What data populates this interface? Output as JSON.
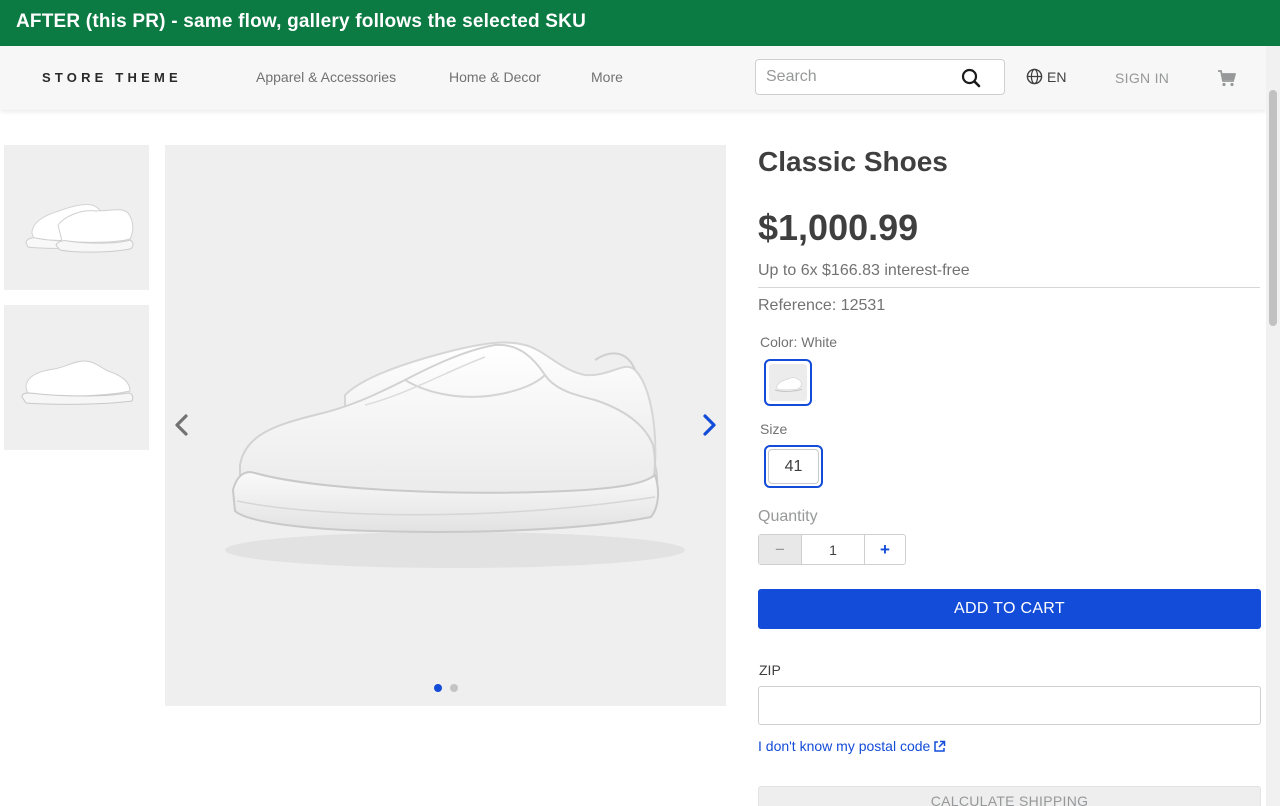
{
  "banner": {
    "text": "AFTER (this PR) - same flow, gallery follows the selected SKU",
    "color": "#0b7a43"
  },
  "header": {
    "logo": "STORE THEME",
    "nav": [
      {
        "label": "Apparel & Accessories"
      },
      {
        "label": "Home & Decor"
      },
      {
        "label": "More"
      }
    ],
    "search": {
      "placeholder": "Search",
      "value": "",
      "icon": "search-icon"
    },
    "language": {
      "label": "EN",
      "icon": "globe-icon"
    },
    "signin_label": "SIGN IN",
    "cart_icon": "cart-icon"
  },
  "gallery": {
    "thumbnails": [
      {
        "icon": "shoe-pair-thumbnail"
      },
      {
        "icon": "shoe-side-thumbnail"
      }
    ],
    "main_image": {
      "icon": "white-slip-on-shoe"
    },
    "prev_icon": "chevron-left-icon",
    "next_icon": "chevron-right-icon",
    "slide_count": 2,
    "active_slide": 1
  },
  "product": {
    "name": "Classic Shoes",
    "price": "$1,000.99",
    "installments": "Up to 6x $166.83 interest-free",
    "reference_label": "Reference:",
    "reference_value": "12531",
    "color_label": "Color:",
    "color_value": "White",
    "size_label": "Size",
    "size_value": "41",
    "quantity_label": "Quantity",
    "quantity_value": "1",
    "minus": "−",
    "plus": "+",
    "add_to_cart": "ADD TO CART"
  },
  "shipping": {
    "zip_label": "ZIP",
    "zip_value": "",
    "postal_link": "I don't know my postal code",
    "calculate_label": "CALCULATE SHIPPING"
  },
  "colors": {
    "accent": "#134cd8",
    "text": "#3f3f40",
    "muted": "#727273"
  }
}
